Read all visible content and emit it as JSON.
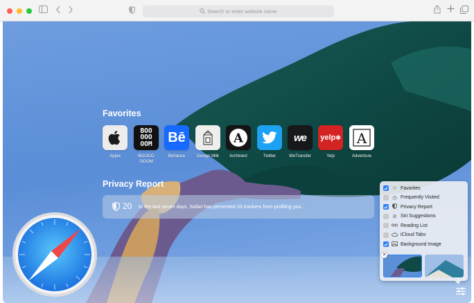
{
  "toolbar": {
    "search_placeholder": "Search or enter website name"
  },
  "favorites": {
    "title": "Favorites",
    "items": [
      {
        "label": "Apple",
        "icon": "apple-icon",
        "bg": "#ececec"
      },
      {
        "label": "BOOOO OOOM",
        "icon": "boooooom-icon",
        "bg": "#111111"
      },
      {
        "label": "Behance",
        "icon": "behance-icon",
        "bg": "#1769ff"
      },
      {
        "label": "Design Milk",
        "icon": "design-milk-icon",
        "bg": "#eeeeee"
      },
      {
        "label": "Archinect",
        "icon": "archinect-icon",
        "bg": "#141414"
      },
      {
        "label": "Twitter",
        "icon": "twitter-icon",
        "bg": "#1da1f2"
      },
      {
        "label": "WeTransfer",
        "icon": "wetransfer-icon",
        "bg": "#17181a"
      },
      {
        "label": "Yelp",
        "icon": "yelp-icon",
        "bg": "#d32323"
      },
      {
        "label": "Adventure",
        "icon": "adventure-icon",
        "bg": "#ffffff"
      }
    ]
  },
  "privacy": {
    "title": "Privacy Report",
    "count": "20",
    "message": "In the last seven days, Safari has prevented 20 trackers from profiling you."
  },
  "customize": {
    "options": [
      {
        "label": "Favorites",
        "checked": true,
        "icon": "star-icon"
      },
      {
        "label": "Frequently Visited",
        "checked": false,
        "icon": "clock-icon"
      },
      {
        "label": "Privacy Report",
        "checked": true,
        "icon": "shield-icon"
      },
      {
        "label": "Siri Suggestions",
        "checked": false,
        "icon": "siri-icon"
      },
      {
        "label": "Reading List",
        "checked": false,
        "icon": "glasses-icon"
      },
      {
        "label": "iCloud Tabs",
        "checked": false,
        "icon": "cloud-icon"
      },
      {
        "label": "Background Image",
        "checked": true,
        "icon": "photo-icon"
      }
    ]
  },
  "colors": {
    "accent": "#2f7ff6",
    "sky": "#5d8fd6"
  }
}
